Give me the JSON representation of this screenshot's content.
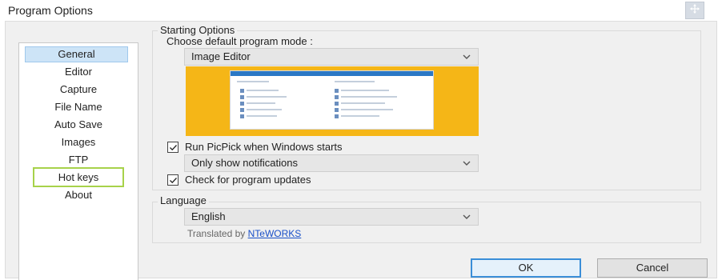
{
  "window": {
    "title": "Program Options"
  },
  "sidebar": {
    "items": [
      {
        "label": "General"
      },
      {
        "label": "Editor"
      },
      {
        "label": "Capture"
      },
      {
        "label": "File Name"
      },
      {
        "label": "Auto Save"
      },
      {
        "label": "Images"
      },
      {
        "label": "FTP"
      },
      {
        "label": "Hot keys"
      },
      {
        "label": "About"
      }
    ],
    "selected": "General",
    "highlighted": "Hot keys"
  },
  "starting_options": {
    "group_title": "Starting Options",
    "mode_label": "Choose default program mode :",
    "mode_value": "Image Editor",
    "run_on_start_label": "Run PicPick when Windows starts",
    "run_on_start_checked": true,
    "notify_value": "Only show notifications",
    "check_updates_label": "Check for program updates",
    "check_updates_checked": true
  },
  "language": {
    "group_title": "Language",
    "value": "English",
    "translated_by_prefix": "Translated by",
    "translator": "NTeWORKS"
  },
  "buttons": {
    "ok": "OK",
    "cancel": "Cancel"
  },
  "colors": {
    "accent": "#3a8ed8",
    "selection": "#cde4f7",
    "highlight_outline": "#a7d24a",
    "preview_background": "#f5b617",
    "link": "#1a50c8"
  },
  "icons": {
    "move": "move-arrows-icon",
    "dropdown": "chevron-down-icon",
    "checkbox": "checkmark-icon"
  }
}
